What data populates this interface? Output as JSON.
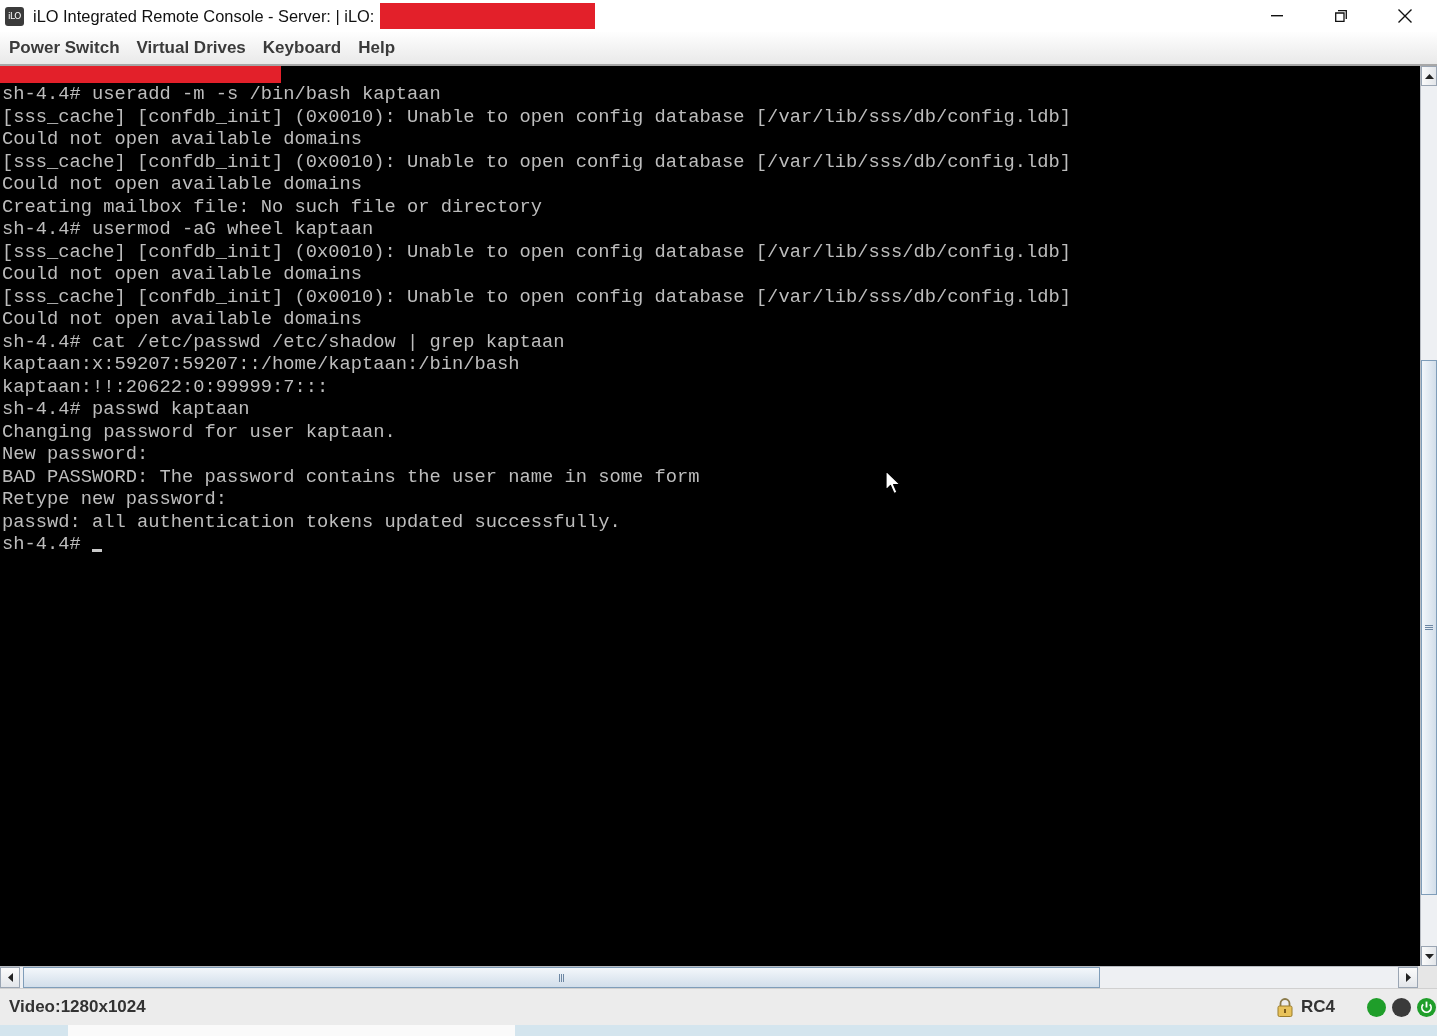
{
  "window": {
    "icon_label": "iLO",
    "title": "iLO Integrated Remote Console - Server: | iLO:",
    "title_redacted": true
  },
  "menu": [
    {
      "label": "Power Switch"
    },
    {
      "label": "Virtual Drives"
    },
    {
      "label": "Keyboard"
    },
    {
      "label": "Help"
    }
  ],
  "console": {
    "top_line_redacted": true,
    "lines": [
      "sh-4.4# useradd -m -s /bin/bash kaptaan",
      "[sss_cache] [confdb_init] (0x0010): Unable to open config database [/var/lib/sss/db/config.ldb]",
      "Could not open available domains",
      "[sss_cache] [confdb_init] (0x0010): Unable to open config database [/var/lib/sss/db/config.ldb]",
      "Could not open available domains",
      "Creating mailbox file: No such file or directory",
      "sh-4.4# usermod -aG wheel kaptaan",
      "[sss_cache] [confdb_init] (0x0010): Unable to open config database [/var/lib/sss/db/config.ldb]",
      "Could not open available domains",
      "[sss_cache] [confdb_init] (0x0010): Unable to open config database [/var/lib/sss/db/config.ldb]",
      "Could not open available domains",
      "sh-4.4# cat /etc/passwd /etc/shadow | grep kaptaan",
      "kaptaan:x:59207:59207::/home/kaptaan:/bin/bash",
      "kaptaan:!!:20622:0:99999:7:::",
      "sh-4.4# passwd kaptaan",
      "Changing password for user kaptaan.",
      "New password:",
      "BAD PASSWORD: The password contains the user name in some form",
      "Retype new password:",
      "passwd: all authentication tokens updated successfully.",
      "sh-4.4#"
    ],
    "cursor_visible": true,
    "pointer_visible": true
  },
  "status_bar": {
    "video": "Video:1280x1024",
    "encryption": "RC4",
    "indicators": [
      {
        "kind": "light",
        "color": "#1f9e2a"
      },
      {
        "kind": "light",
        "color": "#3a3a3a"
      },
      {
        "kind": "power",
        "color": "#1f9e2a"
      }
    ]
  }
}
